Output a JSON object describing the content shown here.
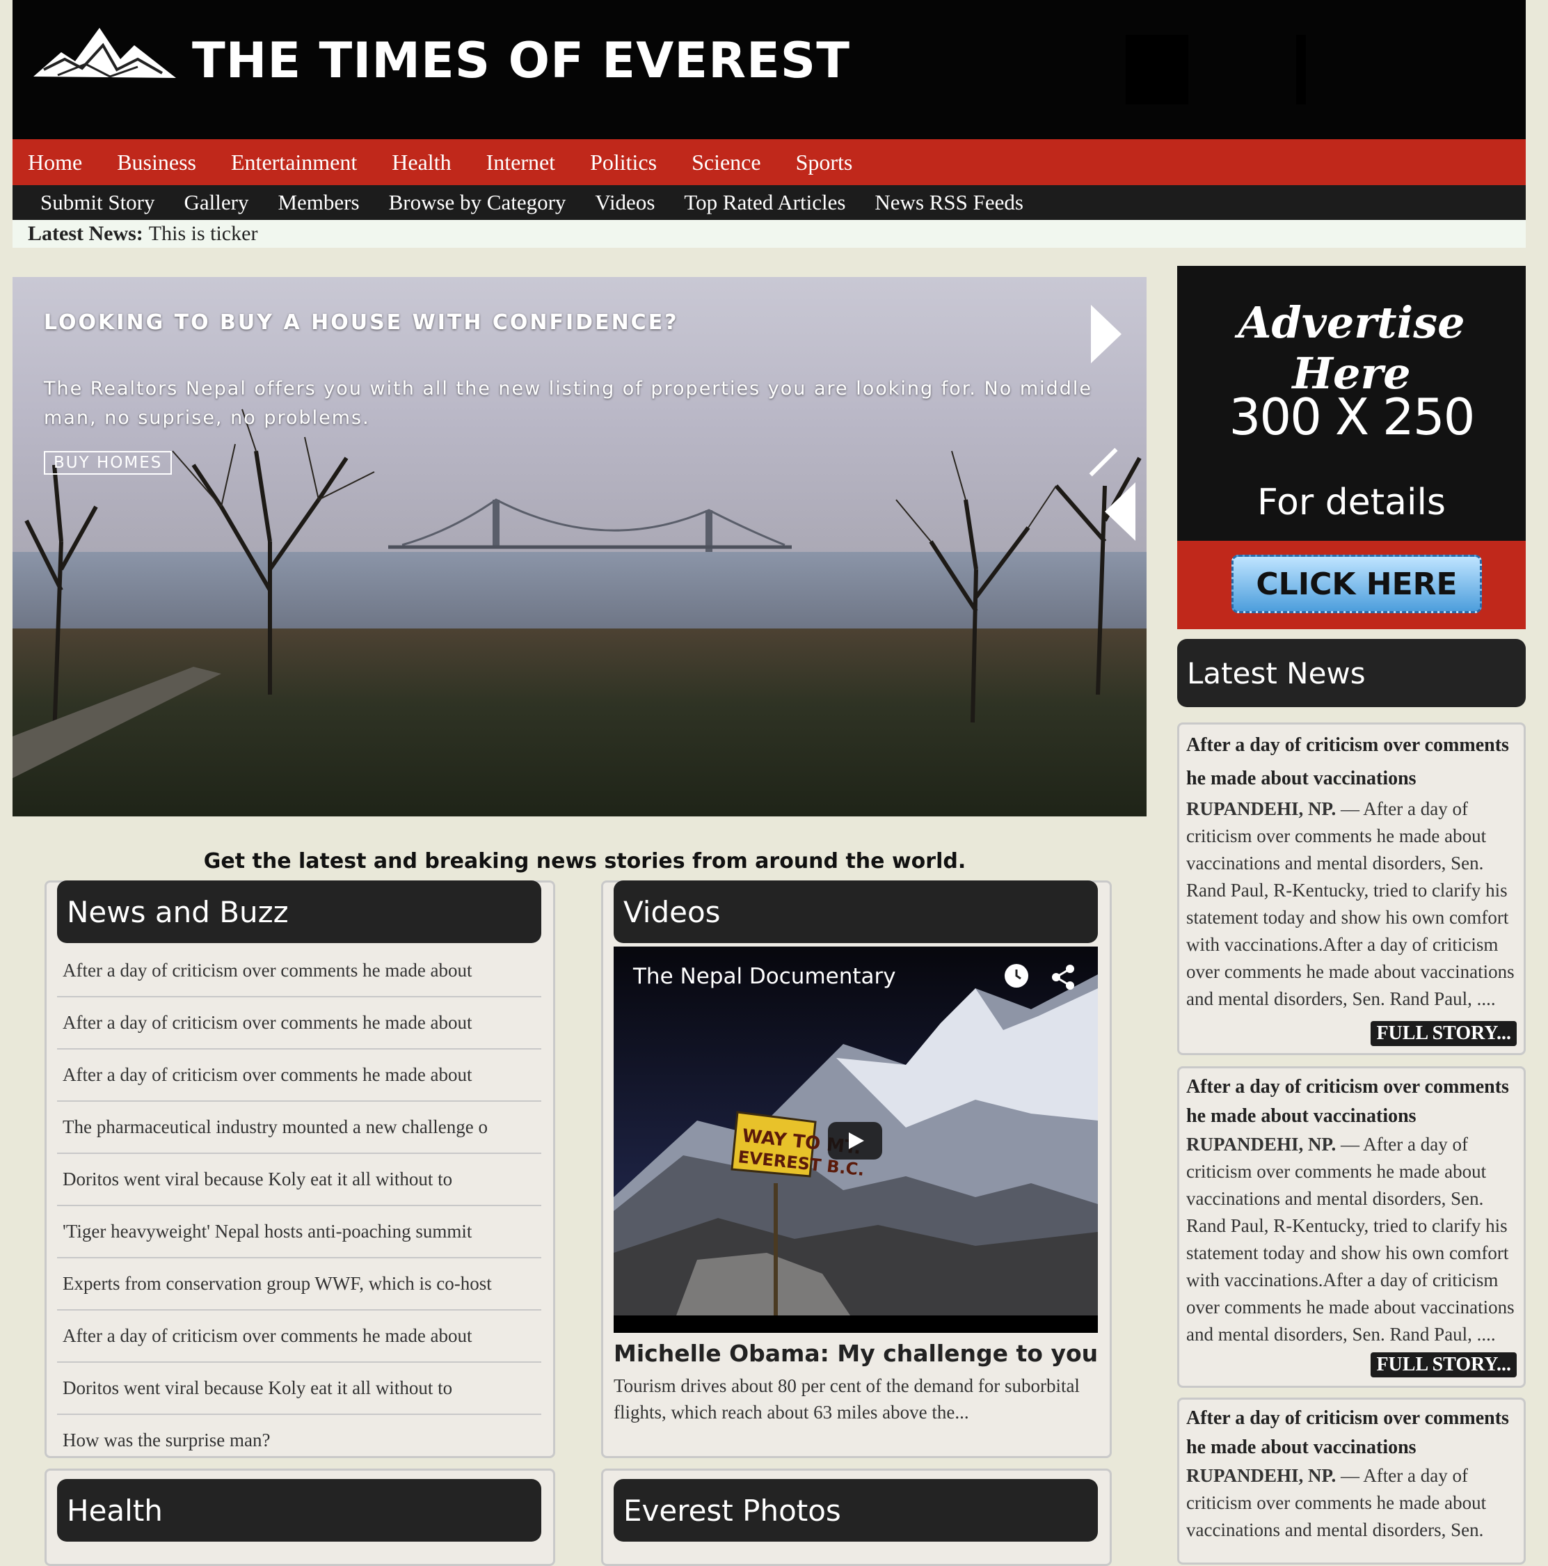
{
  "header": {
    "site_title": "THE TIMES OF EVEREST",
    "logo_icon": "mountain-logo-icon"
  },
  "nav_primary": [
    "Home",
    "Business",
    "Entertainment",
    "Health",
    "Internet",
    "Politics",
    "Science",
    "Sports"
  ],
  "nav_secondary": [
    "Submit Story",
    "Gallery",
    "Members",
    "Browse by Category",
    "Videos",
    "Top Rated Articles",
    "News RSS Feeds"
  ],
  "ticker": {
    "label": "Latest News:",
    "text": "This is ticker"
  },
  "hero": {
    "title": "LOOKING TO BUY A HOUSE WITH CONFIDENCE?",
    "description": "The Realtors Nepal offers you with all the new listing of properties you are looking for. No middle man, no suprise, no problems.",
    "button": "BUY HOMES"
  },
  "tagline": "Get the latest and breaking news stories from around the world.",
  "news_buzz": {
    "heading": "News and Buzz",
    "items": [
      "After a day of criticism over comments he made about",
      "After a day of criticism over comments he made about",
      "After a day of criticism over comments he made about",
      "The pharmaceutical industry mounted a new challenge o",
      "Doritos went viral because Koly eat it all without to",
      "'Tiger heavyweight' Nepal hosts anti-poaching summit",
      "Experts from conservation group WWF, which is co-host",
      "After a day of criticism over comments he made about",
      "Doritos went viral because Koly eat it all without to",
      "How was the surprise man?"
    ]
  },
  "videos": {
    "heading": "Videos",
    "player_title": "The Nepal Documentary",
    "sign_text_1": "WAY TO MT.",
    "sign_text_2": "EVEREST B.C.",
    "headline": "Michelle Obama: My challenge to you",
    "summary": "Tourism drives about 80 per cent of the demand for suborbital flights, which reach about 63 miles above the..."
  },
  "health": {
    "heading": "Health"
  },
  "everest_photos": {
    "heading": "Everest Photos"
  },
  "ad": {
    "line1": "Advertise Here",
    "line2": "300 X 250",
    "line3": "For details",
    "cta": "CLICK HERE"
  },
  "latest_news": {
    "heading": "Latest News",
    "stories": [
      {
        "title": "After a day of criticism over comments he made about vaccinations",
        "dateline": "RUPANDEHI, NP.",
        "body": " — After a day of criticism over comments he made about vaccinations and mental disorders, Sen. Rand Paul, R-Kentucky, tried to clarify his statement today and show his own comfort with vaccinations.After a day of criticism over comments he made about vaccinations and mental disorders, Sen. Rand Paul, ....",
        "button": "FULL STORY..."
      },
      {
        "title": "After a day of criticism over comments he made about vaccinations",
        "dateline": "RUPANDEHI, NP.",
        "body": " — After a day of criticism over comments he made about vaccinations and mental disorders, Sen. Rand Paul, R-Kentucky, tried to clarify his statement today and show his own comfort with vaccinations.After a day of criticism over comments he made about vaccinations and mental disorders, Sen. Rand Paul, ....",
        "button": "FULL STORY..."
      },
      {
        "title": "After a day of criticism over comments he made about vaccinations",
        "dateline": "RUPANDEHI, NP.",
        "body": " — After a day of criticism over comments he made about vaccinations and mental disorders, Sen.",
        "button": ""
      }
    ]
  },
  "colors": {
    "header_bg": "#050505",
    "nav_red": "#c0281b",
    "nav_dark": "#1c1c1c",
    "page_bg": "#e9e8d9",
    "panel_head": "#232323"
  }
}
